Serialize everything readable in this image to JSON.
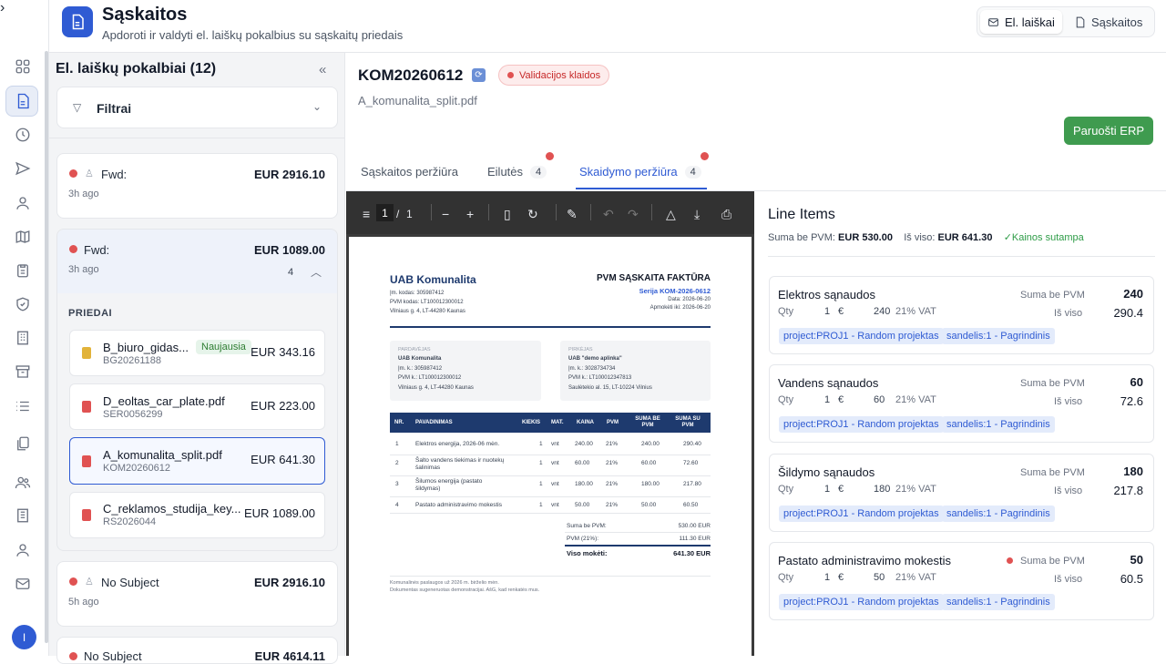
{
  "header": {
    "title": "Sąskaitos",
    "subtitle": "Apdoroti ir valdyti el. laiškų pokalbius su sąskaitų priedais",
    "seg_emails": "El. laiškai",
    "seg_invoices": "Sąskaitos"
  },
  "rail": {
    "avatar_initial": "I"
  },
  "list": {
    "title": "El. laiškų pokalbiai (12)",
    "filter_label": "Filtrai",
    "cards": [
      {
        "sender": "Fwd:",
        "amount": "EUR 2916.10",
        "time": "3h ago"
      },
      {
        "sender": "Fwd:",
        "amount": "EUR 1089.00",
        "time": "3h ago",
        "count": "4"
      },
      {
        "sender": "No Subject",
        "amount": "EUR 2916.10",
        "time": "5h ago"
      },
      {
        "sender": "No Subject",
        "amount": "EUR 4614.11"
      }
    ],
    "attachments_label": "PRIEDAI",
    "attachments": [
      {
        "name": "B_biuro_gidas...",
        "code": "BG20261188",
        "amount": "EUR 343.16",
        "badge": "Naujausia",
        "color": "#e2b33a"
      },
      {
        "name": "D_eoltas_car_plate.pdf",
        "code": "SER0056299",
        "amount": "EUR 223.00",
        "color": "#e05252"
      },
      {
        "name": "A_komunalita_split.pdf",
        "code": "KOM20260612",
        "amount": "EUR 641.30",
        "color": "#e05252"
      },
      {
        "name": "C_reklamos_studija_key...",
        "code": "RS2026044",
        "amount": "EUR 1089.00",
        "color": "#e05252"
      }
    ]
  },
  "doc": {
    "title": "KOM20260612",
    "validation": "Validacijos klaidos",
    "filename": "A_komunalita_split.pdf",
    "erp_button": "Paruošti ERP",
    "tabs": [
      {
        "label": "Sąskaitos peržiūra"
      },
      {
        "label": "Eilutės",
        "count": "4"
      },
      {
        "label": "Skaidymo peržiūra",
        "count": "4"
      }
    ]
  },
  "pdf": {
    "page_current": "1",
    "page_sep": "/",
    "page_total": "1",
    "seller": "UAB Komunalita",
    "seller_code": "Įm. kodas: 305987412",
    "seller_vat": "PVM kodas: LT100012300012",
    "seller_addr": "Vilniaus g. 4, LT-44280 Kaunas",
    "doc_type": "PVM SĄSKAITA FAKTŪRA",
    "series": "Serija KOM-2026-0612",
    "date": "Data: 2026-06-20",
    "due": "Apmokėti iki: 2026-06-20",
    "seller_box_label": "PARDAVĖJAS",
    "seller_box_name": "UAB Komunalita",
    "seller_box_code": "Įm. k.: 305987412",
    "seller_box_vat": "PVM k.: LT100012300012",
    "seller_box_addr": "Vilniaus g. 4, LT-44280 Kaunas",
    "buyer_box_label": "PIRKĖJAS",
    "buyer_box_name": "UAB \"demo aplinka\"",
    "buyer_box_code": "Įm. k.: 3028734734",
    "buyer_box_vat": "PVM k.: LT100012347813",
    "buyer_box_addr": "Saulėtekio al. 15, LT-10224 Vilnius",
    "columns": [
      "NR.",
      "PAVADINIMAS",
      "KIEKIS",
      "MAT.",
      "KAINA",
      "PVM",
      "SUMA BE PVM",
      "SUMA SU PVM"
    ],
    "rows": [
      [
        "1",
        "Elektros energija, 2026-06 mėn.",
        "1",
        "vnt",
        "240.00",
        "21%",
        "240.00",
        "290.40"
      ],
      [
        "2",
        "Šalto vandens tiekimas ir nuotekų šalinimas",
        "1",
        "vnt",
        "60.00",
        "21%",
        "60.00",
        "72.60"
      ],
      [
        "3",
        "Šilumos energija (pastato šildymas)",
        "1",
        "vnt",
        "180.00",
        "21%",
        "180.00",
        "217.80"
      ],
      [
        "4",
        "Pastato administravimo mokestis",
        "1",
        "vnt",
        "50.00",
        "21%",
        "50.00",
        "60.50"
      ]
    ],
    "sum_net_label": "Suma be PVM:",
    "sum_net": "530.00 EUR",
    "sum_vat_label": "PVM (21%):",
    "sum_vat": "111.30 EUR",
    "sum_total_label": "Viso mokėti:",
    "sum_total": "641.30 EUR",
    "note1": "Komunalinės paslaugos už 2026 m. birželio mėn.",
    "note2": "Dokumentas sugeneruotas demonstracijai. AšG, kad renkatės mus."
  },
  "line_items": {
    "title": "Line Items",
    "net_label": "Suma be PVM:",
    "net": "EUR 530.00",
    "gross_label": "Iš viso:",
    "gross": "EUR 641.30",
    "match": "✓Kainos sutampa",
    "net_col": "Suma be PVM",
    "gross_col": "Iš viso",
    "qty_label": "Qty",
    "items": [
      {
        "name": "Elektros sąnaudos",
        "net": "240",
        "qty": "1",
        "cur": "€",
        "price": "240",
        "vat": "21% VAT",
        "total": "290.4",
        "tag1": "project:PROJ1 - Random projektas",
        "tag2": "sandelis:1 - Pagrindinis"
      },
      {
        "name": "Vandens sąnaudos",
        "net": "60",
        "qty": "1",
        "cur": "€",
        "price": "60",
        "vat": "21% VAT",
        "total": "72.6",
        "tag1": "project:PROJ1 - Random projektas",
        "tag2": "sandelis:1 - Pagrindinis"
      },
      {
        "name": "Šildymo sąnaudos",
        "net": "180",
        "qty": "1",
        "cur": "€",
        "price": "180",
        "vat": "21% VAT",
        "total": "217.8",
        "tag1": "project:PROJ1 - Random projektas",
        "tag2": "sandelis:1 - Pagrindinis"
      },
      {
        "name": "Pastato administravimo mokestis",
        "net": "50",
        "qty": "1",
        "cur": "€",
        "price": "50",
        "vat": "21% VAT",
        "total": "60.5",
        "tag1": "project:PROJ1 - Random projektas",
        "tag2": "sandelis:1 - Pagrindinis"
      }
    ]
  }
}
